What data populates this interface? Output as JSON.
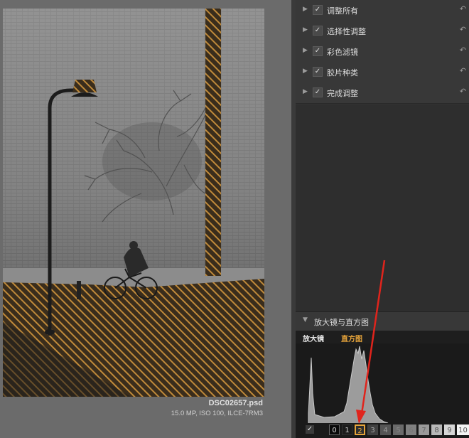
{
  "file": {
    "name": "DSC02657.psd",
    "info": "15.0 MP, ISO 100, ILCE-7RM3"
  },
  "filters": [
    {
      "label": "调整所有",
      "checked": "✓"
    },
    {
      "label": "选择性调整",
      "checked": "✓"
    },
    {
      "label": "彩色滤镜",
      "checked": "✓"
    },
    {
      "label": "胶片种类",
      "checked": "✓"
    },
    {
      "label": "完成调整",
      "checked": "✓"
    }
  ],
  "icons": {
    "expand": "▶",
    "undo": "↶",
    "collapse": "▼"
  },
  "histogram_panel": {
    "title": "放大镜与直方图",
    "tab_loupe": "放大镜",
    "tab_histogram": "直方图",
    "checkbox": "✓"
  },
  "zones": [
    "0",
    "1",
    "2",
    "3",
    "4",
    "5",
    "6",
    "7",
    "8",
    "9",
    "10"
  ],
  "selected_zone": "2",
  "colors": {
    "accent": "#e6a43a",
    "arrow": "#e0241c",
    "panel_bg": "#303030"
  }
}
